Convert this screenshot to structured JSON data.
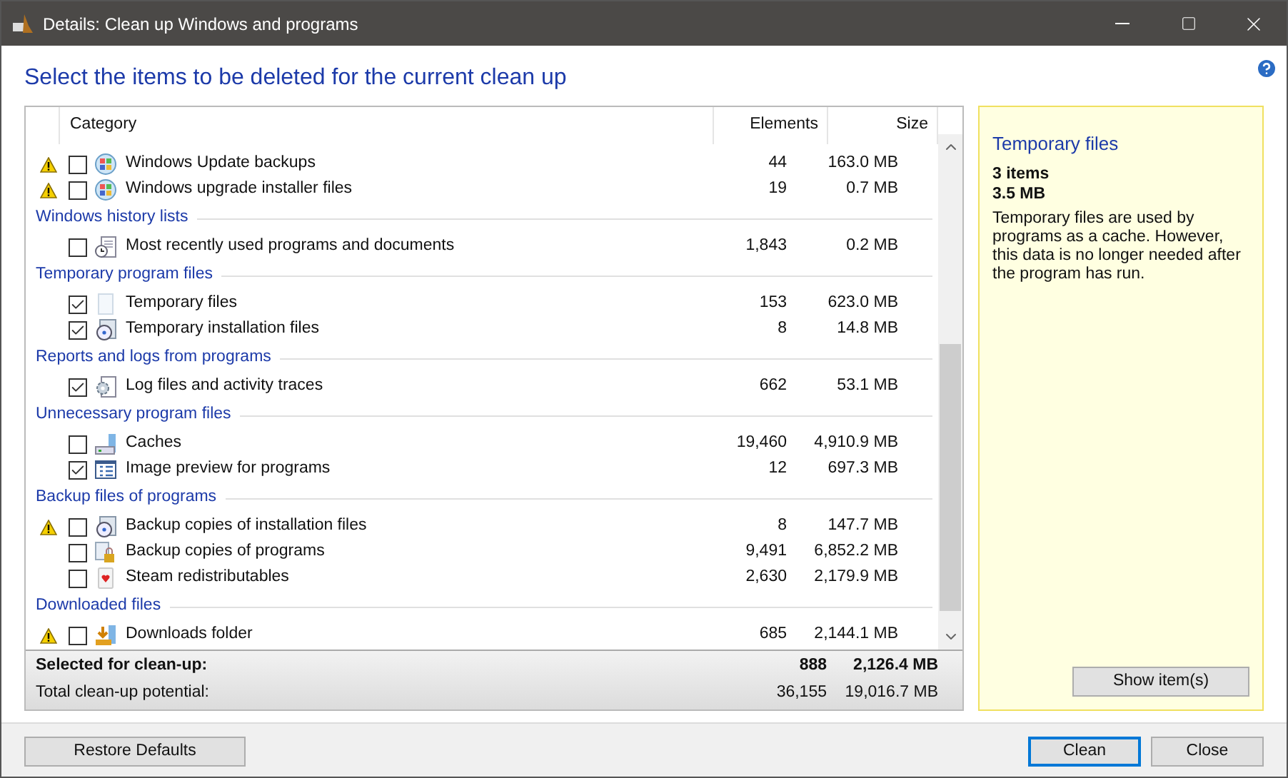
{
  "window": {
    "title": "Details: Clean up Windows and programs"
  },
  "heading": "Select the items to be deleted for the current clean up",
  "table": {
    "columns": [
      "Category",
      "Elements",
      "Size"
    ],
    "groups": [
      {
        "items": [
          {
            "warning": true,
            "checked": false,
            "kind": "windows",
            "name": "Windows Update backups",
            "elements": "44",
            "size": "163.0 MB"
          },
          {
            "warning": true,
            "checked": false,
            "kind": "windows",
            "name": "Windows upgrade installer files",
            "elements": "19",
            "size": "0.7 MB"
          }
        ]
      },
      {
        "title": "Windows history lists",
        "items": [
          {
            "warning": false,
            "checked": false,
            "kind": "clock",
            "name": "Most recently used programs and documents",
            "elements": "1,843",
            "size": "0.2 MB"
          }
        ]
      },
      {
        "title": "Temporary program files",
        "items": [
          {
            "warning": false,
            "checked": true,
            "kind": "page",
            "name": "Temporary files",
            "elements": "153",
            "size": "623.0 MB"
          },
          {
            "warning": false,
            "checked": true,
            "kind": "disc",
            "name": "Temporary installation files",
            "elements": "8",
            "size": "14.8 MB"
          }
        ]
      },
      {
        "title": "Reports and logs from programs",
        "items": [
          {
            "warning": false,
            "checked": true,
            "kind": "gear",
            "name": "Log files and activity traces",
            "elements": "662",
            "size": "53.1 MB"
          }
        ]
      },
      {
        "title": "Unnecessary program files",
        "items": [
          {
            "warning": false,
            "checked": false,
            "kind": "drive",
            "name": "Caches",
            "elements": "19,460",
            "size": "4,910.9 MB"
          },
          {
            "warning": false,
            "checked": true,
            "kind": "grid",
            "name": "Image preview for programs",
            "elements": "12",
            "size": "697.3 MB"
          }
        ]
      },
      {
        "title": "Backup files of programs",
        "items": [
          {
            "warning": true,
            "checked": false,
            "kind": "disc",
            "name": "Backup copies of installation files",
            "elements": "8",
            "size": "147.7 MB"
          },
          {
            "warning": false,
            "checked": false,
            "kind": "lock",
            "name": "Backup copies of programs",
            "elements": "9,491",
            "size": "6,852.2 MB"
          },
          {
            "warning": false,
            "checked": false,
            "kind": "card",
            "name": "Steam redistributables",
            "elements": "2,630",
            "size": "2,179.9 MB"
          }
        ]
      },
      {
        "title": "Downloaded files",
        "items": [
          {
            "warning": true,
            "checked": false,
            "kind": "download",
            "name": "Downloads folder",
            "elements": "685",
            "size": "2,144.1 MB"
          }
        ]
      }
    ],
    "totals": [
      {
        "label": "Selected for clean-up:",
        "elements": "888",
        "size": "2,126.4 MB",
        "bold": true
      },
      {
        "label": "Total clean-up potential:",
        "elements": "36,155",
        "size": "19,016.7 MB",
        "bold": false
      }
    ]
  },
  "info": {
    "title": "Temporary files",
    "count": "3 items",
    "size": "3.5 MB",
    "description": "Temporary files are used by programs as a cache. However, this data is no longer needed after the program has run.",
    "button": "Show item(s)"
  },
  "buttons": {
    "left": "Restore Defaults",
    "primary": "Clean",
    "close": "Close"
  }
}
